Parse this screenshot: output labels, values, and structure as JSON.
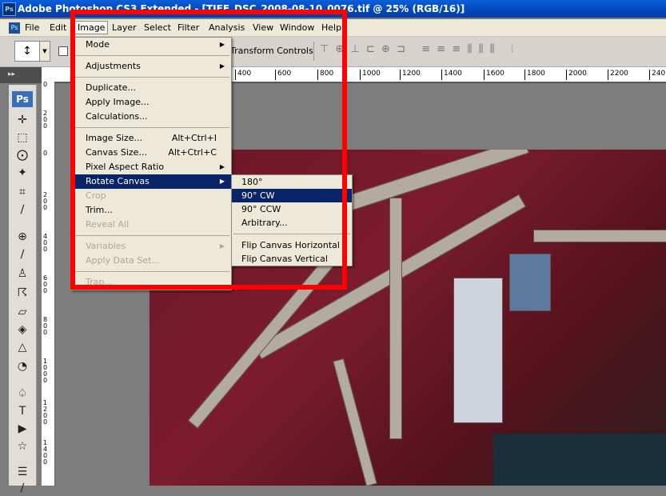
{
  "window": {
    "title": "Adobe Photoshop CS3 Extended - [TIFF_DSC_2008-08-10_0076.tif @ 25% (RGB/16)]",
    "app_badge": "Ps"
  },
  "menubar": {
    "app_icon": "Ps",
    "items": [
      "File",
      "Edit",
      "Image",
      "Layer",
      "Select",
      "Filter",
      "Analysis",
      "View",
      "Window",
      "Help"
    ],
    "active": "Image"
  },
  "options_bar": {
    "transform_label": "Transform Controls",
    "align_icons": "align-distribute-icons"
  },
  "ruler_top": {
    "ticks": [
      "400",
      "600",
      "800",
      "1000",
      "1200",
      "1400",
      "1600",
      "1800",
      "2000",
      "2200",
      "240"
    ]
  },
  "ruler_left": {
    "ticks": [
      "0",
      "2 0 0",
      "0",
      "2 0 0",
      "4 0 0",
      "6 0 0",
      "8 0 0",
      "1 0 0 0",
      "1 2 0 0",
      "1 4 0 0"
    ]
  },
  "toolbox": {
    "logo": "Ps",
    "icons": [
      "move-icon",
      "marquee-icon",
      "lasso-icon",
      "magic-wand-icon",
      "crop-icon",
      "slice-icon",
      "healing-icon",
      "brush-icon",
      "stamp-icon",
      "history-brush-icon",
      "eraser-icon",
      "bucket-icon",
      "blur-icon",
      "dodge-icon",
      "pen-icon",
      "type-icon",
      "path-select-icon",
      "shape-icon",
      "notes-icon",
      "eyedropper-icon"
    ]
  },
  "image_menu": {
    "items": [
      {
        "label": "Mode",
        "shortcut": "",
        "submenu": true,
        "disabled": false
      },
      {
        "sep": true
      },
      {
        "label": "Adjustments",
        "shortcut": "",
        "submenu": true,
        "disabled": false
      },
      {
        "sep": true
      },
      {
        "label": "Duplicate...",
        "shortcut": "",
        "submenu": false,
        "disabled": false
      },
      {
        "label": "Apply Image...",
        "shortcut": "",
        "submenu": false,
        "disabled": false
      },
      {
        "label": "Calculations...",
        "shortcut": "",
        "submenu": false,
        "disabled": false
      },
      {
        "sep": true
      },
      {
        "label": "Image Size...",
        "shortcut": "Alt+Ctrl+I",
        "submenu": false,
        "disabled": false
      },
      {
        "label": "Canvas Size...",
        "shortcut": "Alt+Ctrl+C",
        "submenu": false,
        "disabled": false
      },
      {
        "label": "Pixel Aspect Ratio",
        "shortcut": "",
        "submenu": true,
        "disabled": false
      },
      {
        "label": "Rotate Canvas",
        "shortcut": "",
        "submenu": true,
        "disabled": false,
        "highlighted": true
      },
      {
        "label": "Crop",
        "shortcut": "",
        "submenu": false,
        "disabled": true
      },
      {
        "label": "Trim...",
        "shortcut": "",
        "submenu": false,
        "disabled": false
      },
      {
        "label": "Reveal All",
        "shortcut": "",
        "submenu": false,
        "disabled": true
      },
      {
        "sep": true
      },
      {
        "label": "Variables",
        "shortcut": "",
        "submenu": true,
        "disabled": true
      },
      {
        "label": "Apply Data Set...",
        "shortcut": "",
        "submenu": false,
        "disabled": true
      },
      {
        "sep": true
      },
      {
        "label": "Trap...",
        "shortcut": "",
        "submenu": false,
        "disabled": true
      }
    ]
  },
  "rotate_submenu": {
    "items": [
      {
        "label": "180°"
      },
      {
        "label": "90° CW",
        "highlighted": true
      },
      {
        "label": "90° CCW"
      },
      {
        "label": "Arbitrary..."
      },
      {
        "sep": true
      },
      {
        "label": "Flip Canvas Horizontal"
      },
      {
        "label": "Flip Canvas Vertical"
      }
    ]
  },
  "annotation": {
    "highlight_color": "#ff0000"
  }
}
